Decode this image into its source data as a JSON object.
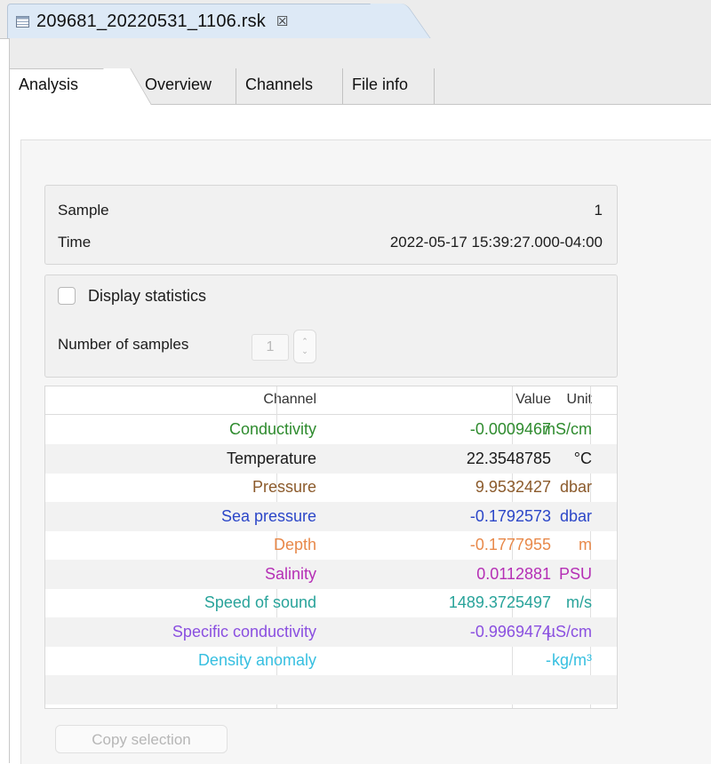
{
  "editor_tab": {
    "title": "209681_20220531_1106.rsk",
    "close_glyph": "☒"
  },
  "subtabs": [
    {
      "label": "Analysis",
      "active": true
    },
    {
      "label": "Overview",
      "active": false
    },
    {
      "label": "Channels",
      "active": false
    },
    {
      "label": "File info",
      "active": false
    }
  ],
  "sample_info": {
    "sample_label": "Sample",
    "sample_value": "1",
    "time_label": "Time",
    "time_value": "2022-05-17 15:39:27.000-04:00"
  },
  "statistics": {
    "display_label": "Display statistics",
    "display_checked": false,
    "num_samples_label": "Number of samples",
    "num_samples_value": "1",
    "spinner_up": "⌃",
    "spinner_down": "⌄"
  },
  "table": {
    "headers": {
      "channel": "Channel",
      "value": "Value",
      "unit": "Unit"
    },
    "rows": [
      {
        "channel": "Conductivity",
        "value": "-0.0009467",
        "unit": "mS/cm",
        "color": "#2e8b2e"
      },
      {
        "channel": "Temperature",
        "value": "22.3548785",
        "unit": "°C",
        "color": "#1a1a1a"
      },
      {
        "channel": "Pressure",
        "value": "9.9532427",
        "unit": "dbar",
        "color": "#8b5a2b"
      },
      {
        "channel": "Sea pressure",
        "value": "-0.1792573",
        "unit": "dbar",
        "color": "#2b46c8"
      },
      {
        "channel": "Depth",
        "value": "-0.1777955",
        "unit": "m",
        "color": "#e8894a"
      },
      {
        "channel": "Salinity",
        "value": "0.0112881",
        "unit": "PSU",
        "color": "#b52fb5"
      },
      {
        "channel": "Speed of sound",
        "value": "1489.3725497",
        "unit": "m/s",
        "color": "#28a39a"
      },
      {
        "channel": "Specific conductivity",
        "value": "-0.9969474",
        "unit": "µS/cm",
        "color": "#8a4fe0"
      },
      {
        "channel": "Density anomaly",
        "value": "-",
        "unit": "kg/m³",
        "color": "#36bfe0"
      }
    ]
  },
  "copy_button": {
    "label": "Copy selection"
  }
}
